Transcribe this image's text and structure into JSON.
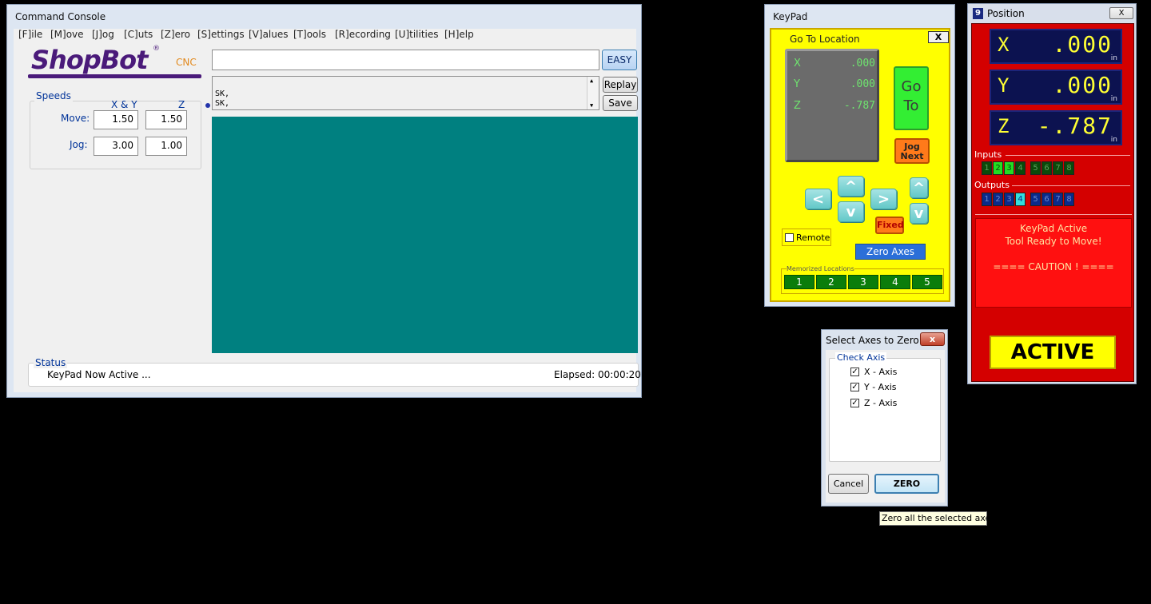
{
  "console": {
    "title": "Command Console",
    "menu": [
      "[F]ile",
      "[M]ove",
      "[J]og",
      "[C]uts",
      "[Z]ero",
      "[S]ettings",
      "[V]alues",
      "[T]ools",
      "[R]ecording",
      "[U]tilities",
      "[H]elp"
    ],
    "logo_text": "ShopBot",
    "logo_reg": "®",
    "logo_cnc": "CNC",
    "command_value": "",
    "easy_label": "EASY",
    "history_lines": [
      "SK,",
      "SK,"
    ],
    "replay_label": "Replay",
    "save_label": "Save",
    "speeds": {
      "legend": "Speeds",
      "col_xy": "X & Y",
      "col_z": "Z",
      "move_label": "Move:",
      "jog_label": "Jog:",
      "move_xy": "1.50",
      "move_z": "1.50",
      "jog_xy": "3.00",
      "jog_z": "1.00"
    },
    "status": {
      "legend": "Status",
      "message": "KeyPad Now Active ...",
      "elapsed": "Elapsed: 00:00:20"
    },
    "display_color": "#008080"
  },
  "keypad": {
    "title": "KeyPad",
    "goto_label": "Go To Location",
    "close_label": "X",
    "dro": [
      {
        "axis": "X",
        "value": ".000"
      },
      {
        "axis": "Y",
        "value": ".000"
      },
      {
        "axis": "Z",
        "value": "-.787"
      }
    ],
    "goto_button": [
      "Go",
      "To"
    ],
    "jog_next": [
      "Jog",
      "Next"
    ],
    "arrows": {
      "left": "<",
      "up": "^",
      "right": ">",
      "down": "v",
      "z_up": "^",
      "z_down": "v"
    },
    "fixed_label": "Fixed",
    "remote_label": "Remote",
    "zero_axes_label": "Zero Axes",
    "memorized_label": "Memorized Locations",
    "memory_buttons": [
      "1",
      "2",
      "3",
      "4",
      "5"
    ]
  },
  "position": {
    "title": "Position",
    "close_label": "X",
    "axes": [
      {
        "axis": "X",
        "value": ".000",
        "unit": "in"
      },
      {
        "axis": "Y",
        "value": ".000",
        "unit": "in"
      },
      {
        "axis": "Z",
        "value": "-.787",
        "unit": "in"
      }
    ],
    "inputs_label": "Inputs",
    "inputs": [
      "1",
      "2",
      "3",
      "4",
      "5",
      "6",
      "7",
      "8"
    ],
    "outputs_label": "Outputs",
    "outputs": [
      "1",
      "2",
      "3",
      "4",
      "5",
      "6",
      "7",
      "8"
    ],
    "message_lines": [
      "KeyPad Active",
      "Tool Ready to Move!",
      "",
      "==== CAUTION ! ===="
    ],
    "active_label": "ACTIVE"
  },
  "zero_dialog": {
    "title": "Select Axes to Zero",
    "close_label": "x",
    "group_label": "Check Axis",
    "axes": [
      {
        "label": "X - Axis",
        "checked": true
      },
      {
        "label": "Y - Axis",
        "checked": true
      },
      {
        "label": "Z - Axis",
        "checked": true
      }
    ],
    "cancel_label": "Cancel",
    "zero_label": "ZERO",
    "tooltip": "Zero all the selected axes"
  }
}
